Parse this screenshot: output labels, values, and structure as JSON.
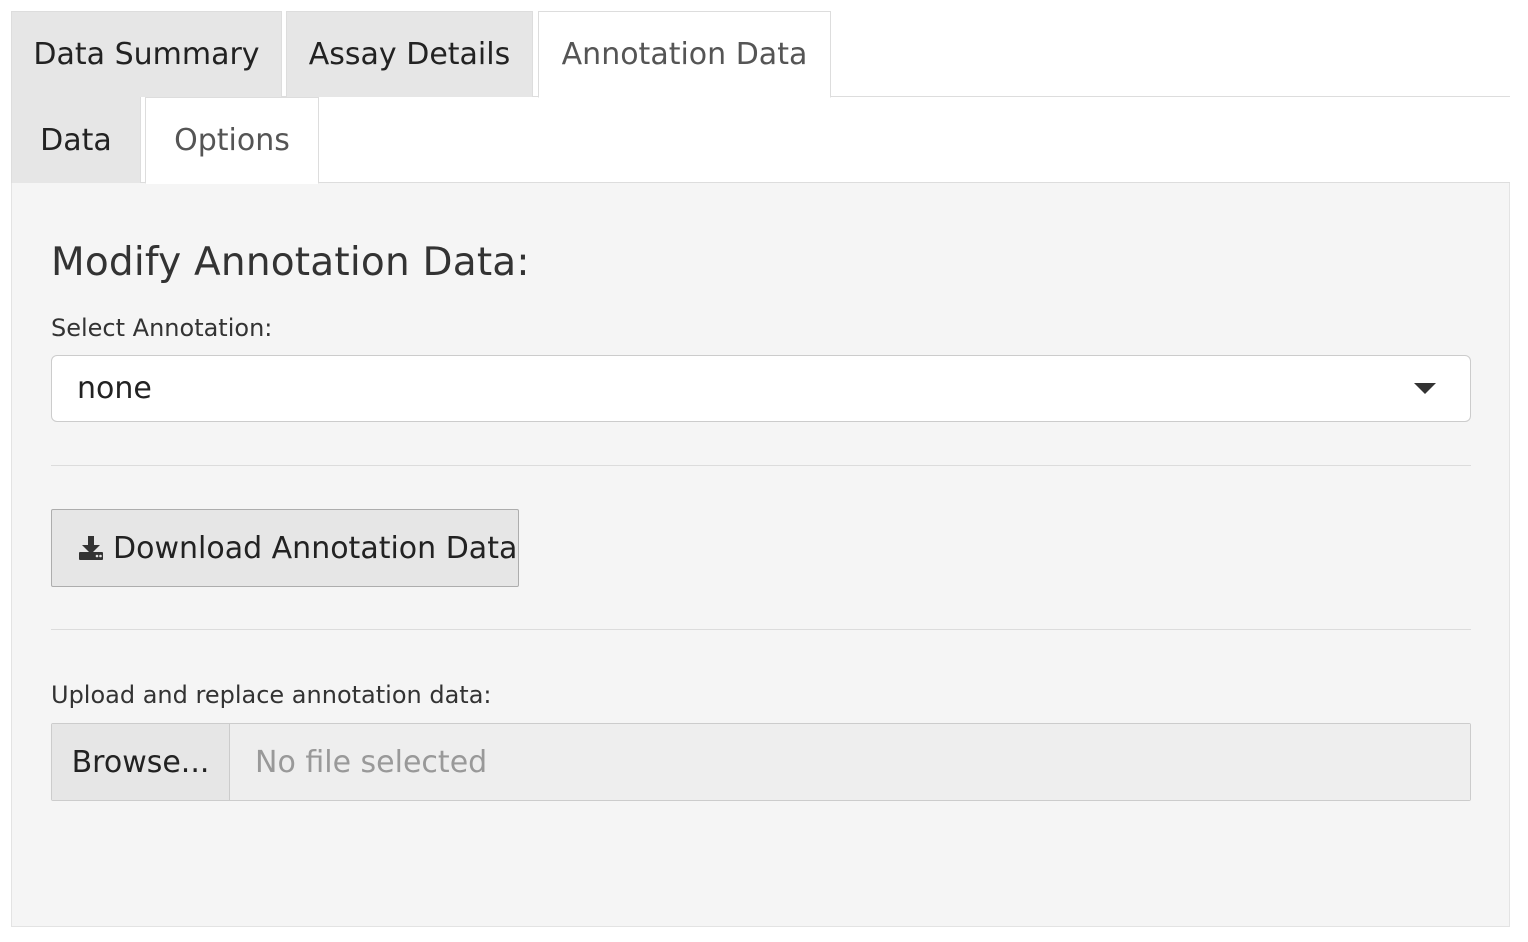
{
  "tabs": {
    "top": [
      {
        "label": "Data Summary",
        "active": false
      },
      {
        "label": "Assay Details",
        "active": false
      },
      {
        "label": "Annotation Data",
        "active": true
      }
    ],
    "sub": [
      {
        "label": "Data",
        "active": false
      },
      {
        "label": "Options",
        "active": true
      }
    ]
  },
  "panel": {
    "heading": "Modify Annotation Data:",
    "select": {
      "label": "Select Annotation:",
      "value": "none",
      "icon": "chevron-down-icon"
    },
    "download_button": {
      "label": "Download Annotation Data",
      "icon": "download-icon"
    },
    "upload": {
      "label": "Upload and replace annotation data:",
      "browse_label": "Browse...",
      "placeholder": "No file selected"
    }
  },
  "colors": {
    "tab_inactive_bg": "#e6e6e6",
    "tab_active_bg": "#ffffff",
    "panel_bg": "#f5f5f5",
    "button_bg": "#e6e6e6",
    "placeholder_text": "#999999"
  }
}
